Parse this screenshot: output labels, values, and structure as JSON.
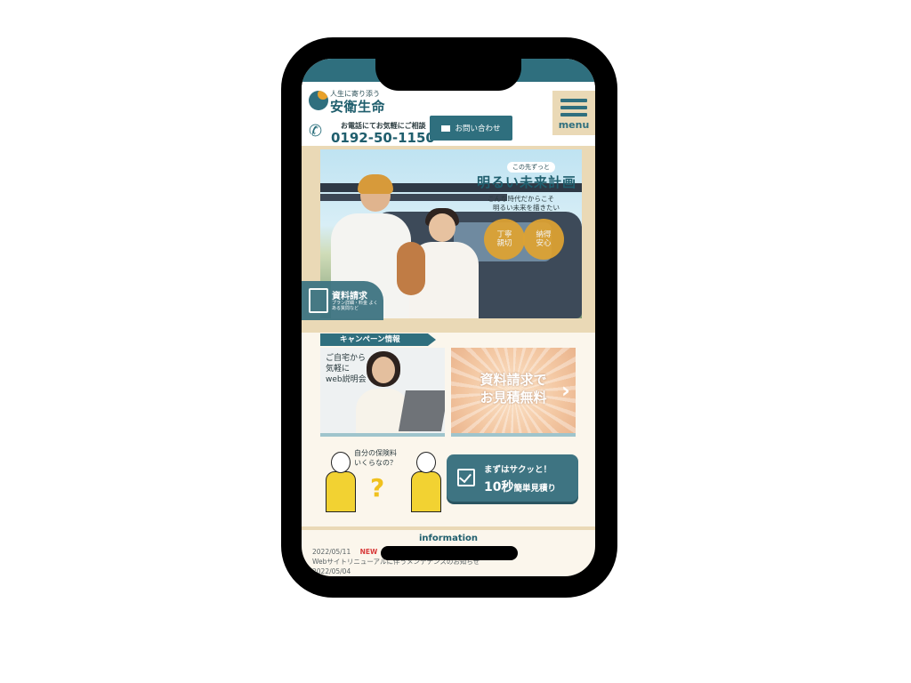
{
  "header": {
    "logo_tagline": "人生に寄り添う",
    "logo_name": "安衛生命",
    "tel_caption": "お電話にてお気軽にご相談",
    "tel_number": "0192-50-1150",
    "contact_label": "お問い合わせ",
    "menu_label": "menu"
  },
  "hero": {
    "subtitle": "この先ずっと",
    "title": "明るい未来計画",
    "line1": "こんな時代だからこそ",
    "line2": "明るい未来を描きたい",
    "badge1": "丁寧\n親切",
    "badge2": "納得\n安心",
    "doc_title": "資料請求",
    "doc_note": "プラン詳細・料金 よくある質問など"
  },
  "campaign": {
    "heading": "キャンペーン情報",
    "card1_text": "ご自宅から\n気軽に\nweb説明会",
    "card2_text": "資料請求で\nお見積無料"
  },
  "estimate": {
    "bubble": "自分の保険料\nいくらなの？",
    "q_mark": "?",
    "button_line1": "まずはサクッと！",
    "button_line2_big": "10秒",
    "button_line2_small": "簡単見積り"
  },
  "information": {
    "title": "information",
    "items": [
      {
        "date": "2022/05/11",
        "badge": "NEW",
        "text": "Webサイトリニューアルに伴うメンテナンスのお知らせ"
      },
      {
        "date": "2022/05/04",
        "badge": "",
        "text": ""
      }
    ]
  },
  "colors": {
    "primary": "#2f6f7e",
    "accent": "#e0a331",
    "beige": "#ead9b6"
  }
}
